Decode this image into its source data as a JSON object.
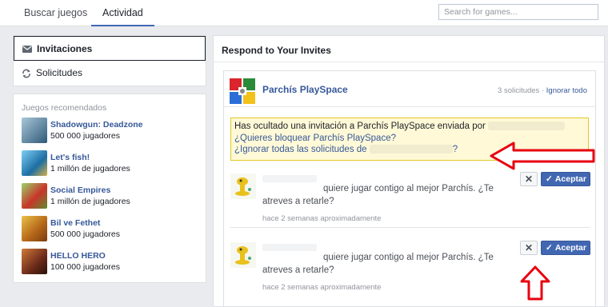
{
  "topnav": {
    "tabs": [
      {
        "label": "Buscar juegos",
        "active": false
      },
      {
        "label": "Actividad",
        "active": true
      }
    ],
    "search_placeholder": "Search for games..."
  },
  "sidebar": {
    "items": [
      {
        "label": "Invitaciones",
        "icon": "envelope-icon",
        "active": true
      },
      {
        "label": "Solicitudes",
        "icon": "refresh-icon",
        "active": false
      }
    ]
  },
  "recommended": {
    "title": "Juegos recomendados",
    "games": [
      {
        "name": "Shadowgun: Deadzone",
        "users": "500 000 jugadores",
        "color": "#2f5a78"
      },
      {
        "name": "Let's fish!",
        "users": "1 millón de jugadores",
        "color": "#2c8bc9"
      },
      {
        "name": "Social Empires",
        "users": "1 millón de jugadores",
        "color": "#5e8c2e"
      },
      {
        "name": "Bil ve Fethet",
        "users": "500 000 jugadores",
        "color": "#b86a1a"
      },
      {
        "name": "HELLO HERO",
        "users": "100 000 jugadores",
        "color": "#6b2a1a"
      }
    ]
  },
  "main": {
    "title": "Respond to Your Invites",
    "app": {
      "name": "Parchís PlaySpace",
      "count": "3 solicitudes",
      "separator": "·",
      "ignore_all": "Ignorar todo"
    },
    "notice": {
      "line1": "Has ocultado una invitación a Parchís PlaySpace enviada por",
      "line2": "¿Quieres bloquear Parchís PlaySpace?",
      "line3_prefix": "¿Ignorar todas las solicitudes de",
      "line3_suffix": "?"
    },
    "requests": [
      {
        "text": "quiere jugar contigo al mejor Parchís. ¿Te atreves a retarle?",
        "time": "hace 2 semanas aproximadamente",
        "accept_label": "Aceptar"
      },
      {
        "text": "quiere jugar contigo al mejor Parchís. ¿Te atreves a retarle?",
        "time": "hace 2 semanas aproximadamente",
        "accept_label": "Aceptar"
      }
    ]
  },
  "colors": {
    "accent": "#4267b2",
    "link": "#365899",
    "annotation": "#e8000f",
    "notice_bg": "#fff9d7"
  }
}
